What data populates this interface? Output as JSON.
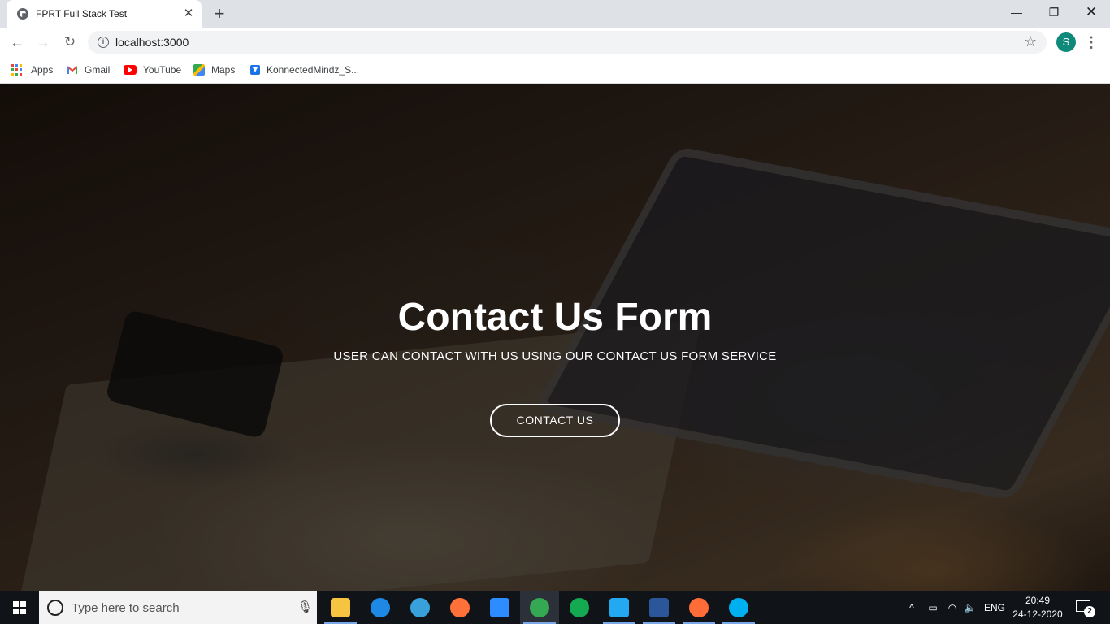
{
  "browser": {
    "tab_title": "FPRT Full Stack Test",
    "tab_close": "✕",
    "new_tab": "+",
    "window": {
      "minimize": "—",
      "maximize": "❐",
      "close": "✕"
    },
    "nav": {
      "back": "←",
      "forward": "→",
      "reload": "↻"
    },
    "url": "localhost:3000",
    "profile_initial": "S",
    "menu": "⋮",
    "star": "☆"
  },
  "bookmarks": [
    {
      "label": "Apps",
      "icon": "apps-grid-icon"
    },
    {
      "label": "Gmail",
      "icon": "gmail-icon"
    },
    {
      "label": "YouTube",
      "icon": "youtube-icon"
    },
    {
      "label": "Maps",
      "icon": "maps-icon"
    },
    {
      "label": "KonnectedMindz_S...",
      "icon": "bookmark-site-icon"
    }
  ],
  "hero": {
    "title": "Contact Us Form",
    "subtitle": "USER CAN CONTACT WITH US USING OUR CONTACT US FORM SERVICE",
    "cta_label": "CONTACT US"
  },
  "taskbar": {
    "search_placeholder": "Type here to search",
    "apps": [
      {
        "name": "file-explorer",
        "color": "#f5c542"
      },
      {
        "name": "edge-legacy",
        "color": "#1e88e5"
      },
      {
        "name": "internet-explorer",
        "color": "#38a1db"
      },
      {
        "name": "firefox",
        "color": "#ff7139"
      },
      {
        "name": "zoom",
        "color": "#2d8cff"
      },
      {
        "name": "chrome",
        "color": "#34a853"
      },
      {
        "name": "mongodb-compass",
        "color": "#13aa52"
      },
      {
        "name": "vscode",
        "color": "#23a9f2"
      },
      {
        "name": "word",
        "color": "#2b579a"
      },
      {
        "name": "postman",
        "color": "#ff6c37"
      },
      {
        "name": "skype",
        "color": "#00aff0"
      }
    ],
    "tray": {
      "chevron": "^",
      "language": "ENG",
      "time": "20:49",
      "date": "24-12-2020",
      "notification_count": "2"
    }
  },
  "colors": {
    "accent_profile": "#0f8a7a",
    "cta_border": "#ffffff",
    "taskbar_bg": "#101318"
  }
}
